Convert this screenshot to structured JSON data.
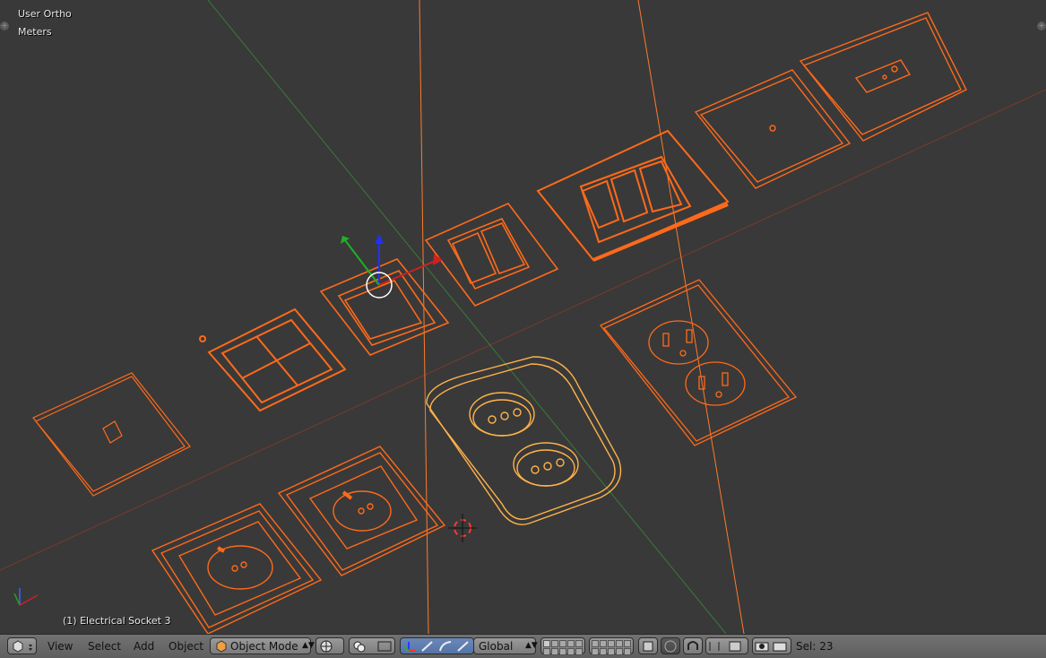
{
  "viewport": {
    "view_name": "User Ortho",
    "units": "Meters",
    "selected_object": "(1) Electrical Socket 3"
  },
  "header": {
    "menus": [
      "View",
      "Select",
      "Add",
      "Object"
    ],
    "mode": "Object Mode",
    "orientation": "Global",
    "selection_count": "Sel: 23"
  },
  "colors": {
    "background": "#393939",
    "selected_wire": "#ff6a1a",
    "active_wire": "#ffb24a",
    "x_axis": "#b33b2a",
    "y_axis": "#2e8a2e"
  },
  "icons": [
    "editor-type-icon",
    "viewport-shading-icon",
    "pivot-icon",
    "manipulator-icon",
    "translate-icon",
    "rotate-icon",
    "scale-icon",
    "layers-icon",
    "proportional-edit-icon",
    "snap-icon",
    "render-icon",
    "camera-icon"
  ]
}
